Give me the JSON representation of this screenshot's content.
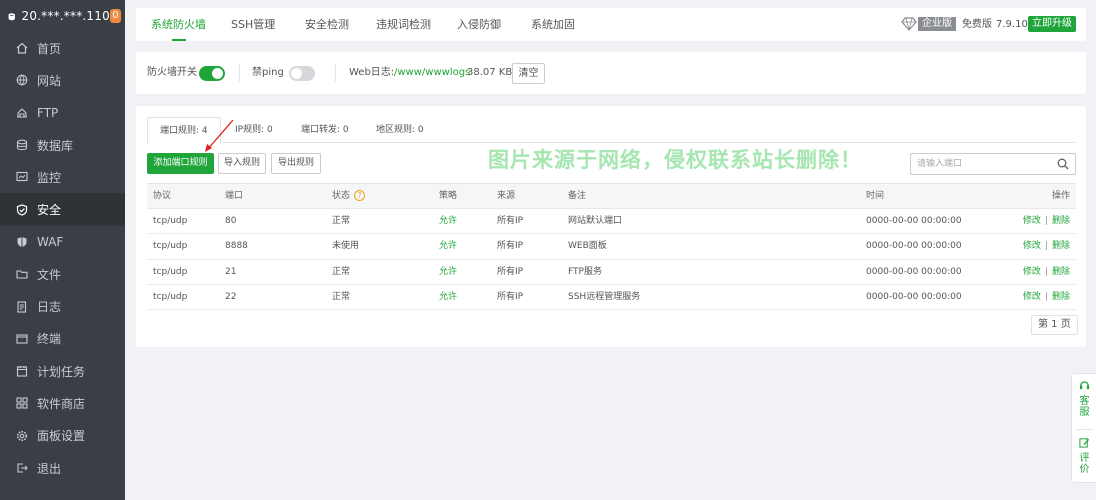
{
  "sidebar": {
    "server_ip": "20.***.***.110",
    "badge_count": "0",
    "items": [
      {
        "label": "首页",
        "icon": "home-icon"
      },
      {
        "label": "网站",
        "icon": "globe-icon"
      },
      {
        "label": "FTP",
        "icon": "ftp-icon"
      },
      {
        "label": "数据库",
        "icon": "database-icon"
      },
      {
        "label": "监控",
        "icon": "monitor-icon"
      },
      {
        "label": "安全",
        "icon": "shield-check-icon",
        "active": true
      },
      {
        "label": "WAF",
        "icon": "waf-shield-icon"
      },
      {
        "label": "文件",
        "icon": "folder-icon"
      },
      {
        "label": "日志",
        "icon": "log-icon"
      },
      {
        "label": "终端",
        "icon": "terminal-icon"
      },
      {
        "label": "计划任务",
        "icon": "calendar-icon"
      },
      {
        "label": "软件商店",
        "icon": "apps-icon"
      },
      {
        "label": "面板设置",
        "icon": "gear-icon"
      },
      {
        "label": "退出",
        "icon": "logout-icon"
      }
    ]
  },
  "topnav": {
    "tabs": [
      "系统防火墙",
      "SSH管理",
      "安全检测",
      "违规词检测",
      "入侵防御",
      "系统加固"
    ],
    "active_tab": "系统防火墙",
    "enterprise_label": "企业版",
    "free_label": "免费版",
    "version": "7.9.10",
    "upgrade_label": "立即升级"
  },
  "firewall": {
    "switch_label": "防火墙开关",
    "switch_on": true,
    "noping_label": "禁ping",
    "noping_on": false,
    "weblog_label": "Web日志:",
    "weblog_path": "/www/wwwlogs",
    "weblog_size": "38.07 KB",
    "clear_label": "清空"
  },
  "rules": {
    "subtabs": [
      "端口规则: 4",
      "IP规则: 0",
      "端口转发: 0",
      "地区规则: 0"
    ],
    "add_button": "添加端口规则",
    "import_button": "导入规则",
    "export_button": "导出规则",
    "watermark": "图片来源于网络，侵权联系站长删除！",
    "search_placeholder": "请输入端口",
    "columns": [
      "协议",
      "端口",
      "状态",
      "策略",
      "来源",
      "备注",
      "时间",
      "操作"
    ],
    "status_help": "?",
    "rows": [
      {
        "protocol": "tcp/udp",
        "port": "80",
        "status": "正常",
        "policy": "允许",
        "source": "所有IP",
        "note": "网站默认端口",
        "time": "0000-00-00 00:00:00"
      },
      {
        "protocol": "tcp/udp",
        "port": "8888",
        "status": "未使用",
        "policy": "允许",
        "source": "所有IP",
        "note": "WEB面板",
        "time": "0000-00-00 00:00:00"
      },
      {
        "protocol": "tcp/udp",
        "port": "21",
        "status": "正常",
        "policy": "允许",
        "source": "所有IP",
        "note": "FTP服务",
        "time": "0000-00-00 00:00:00"
      },
      {
        "protocol": "tcp/udp",
        "port": "22",
        "status": "正常",
        "policy": "允许",
        "source": "所有IP",
        "note": "SSH远程管理服务",
        "time": "0000-00-00 00:00:00"
      }
    ],
    "edit_label": "修改",
    "delete_label": "删除",
    "op_sep": "|",
    "pager": "第 1 页"
  },
  "float_widget": {
    "service_label": "客服",
    "review_label": "评价"
  },
  "colors": {
    "accent": "#20a53a",
    "sidebar_bg": "#3a3f47",
    "badge": "#f0883e",
    "watermark": "#a6e6b0"
  }
}
